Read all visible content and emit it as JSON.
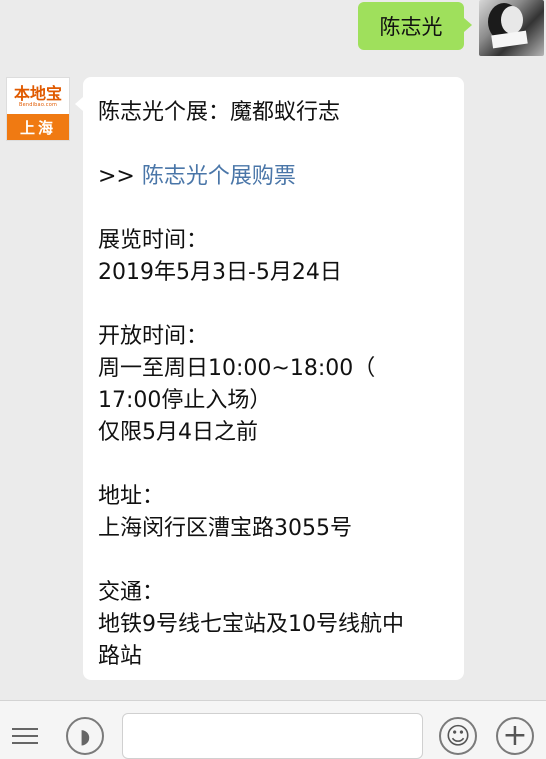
{
  "user": {
    "nickname": "陈志光"
  },
  "bot": {
    "avatar_title": "本地宝",
    "avatar_sub": "Bendibao.com",
    "avatar_city": "上海",
    "message": {
      "title": "陈志光个展：魔都蚁行志",
      "link_prefix": ">>",
      "link_text": "陈志光个展购票",
      "exhibition_time_label": "展览时间：",
      "exhibition_time": "2019年5月3日-5月24日",
      "opening_hours_label": "开放时间：",
      "opening_hours_1": "周一至周日10:00~18:00（",
      "opening_hours_2": "17:00停止入场）",
      "opening_hours_note": "仅限5月4日之前",
      "address_label": "地址：",
      "address": "上海闵行区漕宝路3055号",
      "transport_label": "交通：",
      "transport_1": "地铁9号线七宝站及10号线航中",
      "transport_2": "路站"
    }
  },
  "input_bar": {
    "icons": [
      "menu-icon",
      "voice-icon",
      "emoji-icon",
      "plus-icon"
    ]
  }
}
